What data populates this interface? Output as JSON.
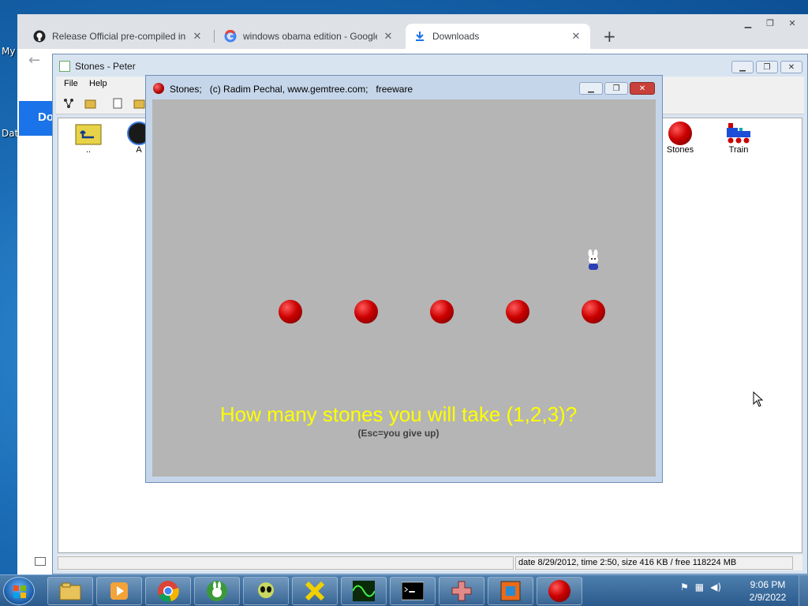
{
  "desktop": {
    "icon_labels": [
      "My",
      "Dat"
    ]
  },
  "chrome": {
    "tabs": [
      {
        "title": "Release Official pre-compiled ins",
        "icon": "github-icon"
      },
      {
        "title": "windows obama edition - Google",
        "icon": "google-icon"
      },
      {
        "title": "Downloads",
        "icon": "download-icon"
      }
    ],
    "close_glyph": "✕",
    "new_tab_glyph": "+",
    "downloads_label": "Do"
  },
  "peter": {
    "title": "Stones - Peter",
    "menu": {
      "file": "File",
      "help": "Help"
    },
    "files": [
      {
        "label": "..",
        "icon": "up-folder-icon"
      },
      {
        "label": "A",
        "icon": "app-icon"
      },
      {
        "label": "Stones",
        "icon": "stone-icon"
      },
      {
        "label": "Train",
        "icon": "train-icon"
      }
    ],
    "status": "date 8/29/2012, time 2:50, size 416 KB / free 118224 MB"
  },
  "stones": {
    "title": "Stones;   (c) Radim Pechal, www.gemtree.com;   freeware",
    "stone_count": 5,
    "prompt": "How many stones you will take (1,2,3)?",
    "hint": "(Esc=you give up)"
  },
  "taskbar": {
    "time": "9:06 PM",
    "date": "2/9/2022",
    "apps": [
      "explorer-icon",
      "media-player-icon",
      "chrome-icon",
      "rabbit-app-icon",
      "alien-app-icon",
      "x-app-icon",
      "oscilloscope-icon",
      "cmd-icon",
      "grid-cross-icon",
      "puzzle-icon",
      "stones-app-icon"
    ]
  },
  "colors": {
    "prompt": "#ffff00",
    "stone": "#c00000",
    "canvas": "#b5b5b5",
    "taskbar": "#2b5a8c"
  }
}
